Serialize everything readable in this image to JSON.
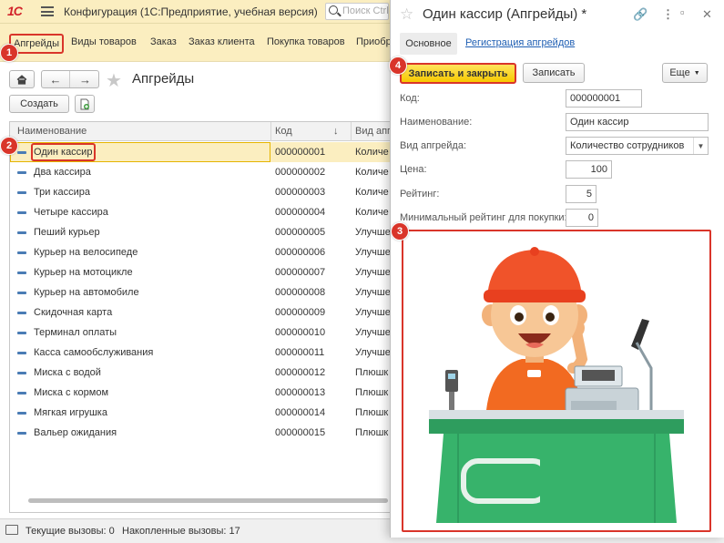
{
  "app": {
    "logo_text": "1С",
    "title": "Конфигурация  (1С:Предприятие, учебная версия)",
    "search_placeholder": "Поиск Ctrl"
  },
  "sections": [
    "Апгрейды",
    "Виды товаров",
    "Заказ",
    "Заказ клиента",
    "Покупка товаров",
    "Приобр"
  ],
  "list": {
    "title": "Апгрейды",
    "create_label": "Создать",
    "columns": {
      "name": "Наименование",
      "code": "Код",
      "type": "Вид апг"
    },
    "rows": [
      {
        "name": "Один кассир",
        "code": "000000001",
        "type": "Количе"
      },
      {
        "name": "Два кассира",
        "code": "000000002",
        "type": "Количе"
      },
      {
        "name": "Три кассира",
        "code": "000000003",
        "type": "Количе"
      },
      {
        "name": "Четыре кассира",
        "code": "000000004",
        "type": "Количе"
      },
      {
        "name": "Пеший курьер",
        "code": "000000005",
        "type": "Улучше"
      },
      {
        "name": "Курьер на велосипеде",
        "code": "000000006",
        "type": "Улучше"
      },
      {
        "name": "Курьер на мотоцикле",
        "code": "000000007",
        "type": "Улучше"
      },
      {
        "name": "Курьер на автомобиле",
        "code": "000000008",
        "type": "Улучше"
      },
      {
        "name": "Скидочная карта",
        "code": "000000009",
        "type": "Улучше"
      },
      {
        "name": "Терминал оплаты",
        "code": "000000010",
        "type": "Улучше"
      },
      {
        "name": "Касса самообслуживания",
        "code": "000000011",
        "type": "Улучше"
      },
      {
        "name": "Миска с водой",
        "code": "000000012",
        "type": "Плюшк"
      },
      {
        "name": "Миска с кормом",
        "code": "000000013",
        "type": "Плюшк"
      },
      {
        "name": "Мягкая игрушка",
        "code": "000000014",
        "type": "Плюшк"
      },
      {
        "name": "Вальер ожидания",
        "code": "000000015",
        "type": "Плюшк"
      }
    ]
  },
  "status": {
    "current_calls": "Текущие вызовы: 0",
    "accumulated_calls": "Накопленные вызовы: 17"
  },
  "form": {
    "title": "Один кассир (Апгрейды) *",
    "tab_main": "Основное",
    "tab_link": "Регистрация апгрейдов",
    "save_close_label": "Записать и закрыть",
    "save_label": "Записать",
    "more_label": "Еще",
    "fields": {
      "code_label": "Код:",
      "code_value": "000000001",
      "name_label": "Наименование:",
      "name_value": "Один кассир",
      "type_label": "Вид апгрейда:",
      "type_value": "Количество сотрудников",
      "price_label": "Цена:",
      "price_value": "100",
      "rating_label": "Рейтинг:",
      "rating_value": "5",
      "min_rating_label": "Минимальный рейтинг для покупки:",
      "min_rating_value": "0"
    }
  },
  "badges": [
    "1",
    "2",
    "3",
    "4"
  ],
  "colors": {
    "accent_red": "#d9352a",
    "highlight_yellow": "#fbeec0",
    "button_yellow": "#f7c900",
    "link_blue": "#1f5fb3"
  }
}
